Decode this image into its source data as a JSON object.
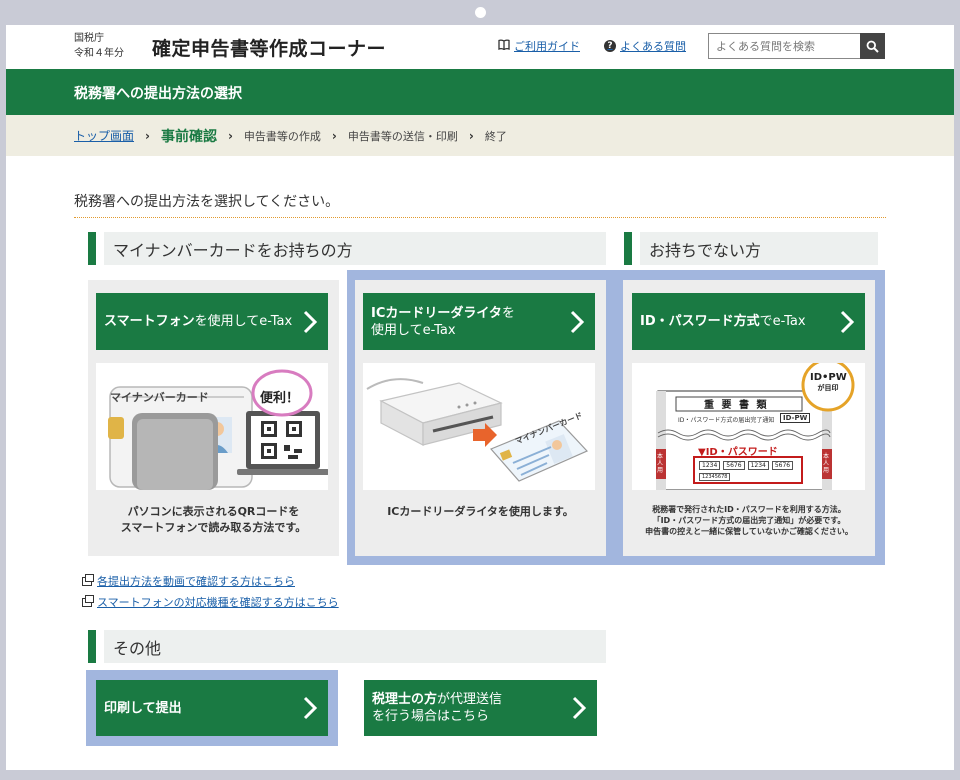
{
  "header": {
    "agency_line1": "国税庁",
    "agency_line2": "令和４年分",
    "title": "確定申告書等作成コーナー",
    "guide_link": "ご利用ガイド",
    "faq_link": "よくある質問",
    "search_placeholder": "よくある質問を検索"
  },
  "page_heading": "税務署への提出方法の選択",
  "breadcrumb": {
    "home": "トップ画面",
    "current": "事前確認",
    "step3": "申告書等の作成",
    "step4": "申告書等の送信・印刷",
    "step5": "終了"
  },
  "instruction": "税務署への提出方法を選択してください。",
  "sections": {
    "mynumber": "マイナンバーカードをお持ちの方",
    "no_card": "お持ちでない方",
    "other": "その他"
  },
  "cards": {
    "smartphone": {
      "btn_bold": "スマートフォン",
      "btn_rest": "を使用してe-Tax",
      "desc1": "パソコンに表示されるQRコードを",
      "desc2": "スマートフォンで読み取る方法です。",
      "card_label": "マイナンバーカード",
      "bubble": "便利！"
    },
    "icreader": {
      "btn_bold": "ICカードリーダライタ",
      "btn_rest1": "を",
      "btn_rest2": "使用してe-Tax",
      "desc": "ICカードリーダライタを使用します。",
      "card_label": "マイナンバーカード"
    },
    "idpw": {
      "btn_bold": "ID・パスワード方式",
      "btn_rest": "でe-Tax",
      "desc1": "税務署で発行されたID・パスワードを利用する方法。",
      "desc2": "「ID・パスワード方式の届出完了通知」が必要です。",
      "desc3": "申告書の控えと一緒に保管していないかご確認ください。",
      "doc_title": "重 要 書 類",
      "doc_sub": "ID・パスワード方式の届出完了通知",
      "doc_tag": "ID-PW",
      "stamp1": "ID•PW",
      "stamp2": "が目印",
      "pw_label": "▼ID・パスワード",
      "side_label": "本人用",
      "nums": [
        "1234",
        "5676",
        "1234",
        "5676"
      ],
      "num_small": "12345678"
    }
  },
  "info_links": {
    "video": "各提出方法を動画で確認する方はこちら",
    "devices": "スマートフォンの対応機種を確認する方はこちら"
  },
  "other_buttons": {
    "print": "印刷して提出",
    "tax_acct_bold": "税理士の方",
    "tax_acct_rest1": "が代理送信",
    "tax_acct_rest2": "を行う場合はこちら"
  },
  "colors": {
    "brand_green": "#1a7a43",
    "highlight": "#a2b6de",
    "card_bg": "#ededed",
    "crumb_bg": "#efede1"
  }
}
